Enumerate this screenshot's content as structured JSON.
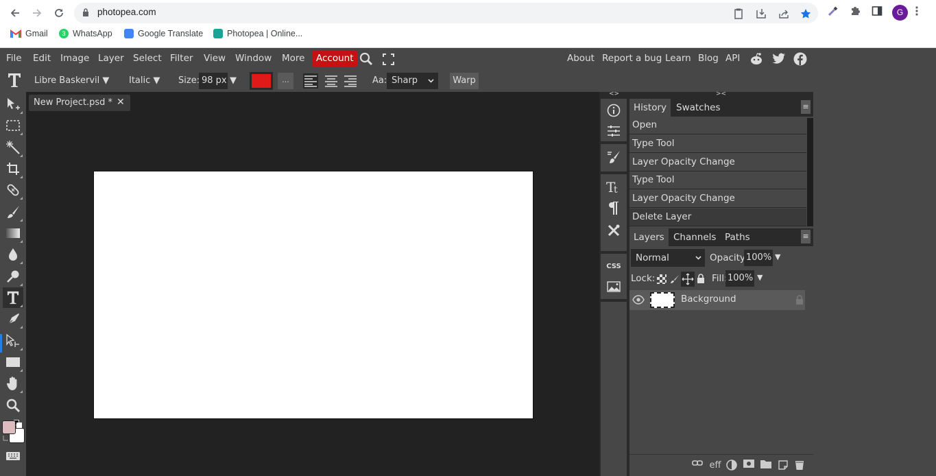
{
  "browser": {
    "url": "photopea.com",
    "bookmarks": [
      {
        "label": "Gmail",
        "icon": "gmail-icon"
      },
      {
        "label": "WhatsApp",
        "icon": "whatsapp-icon",
        "badge": "3"
      },
      {
        "label": "Google Translate",
        "icon": "google-translate-icon"
      },
      {
        "label": "Photopea | Online...",
        "icon": "photopea-icon"
      }
    ],
    "profile_initial": "G",
    "colors": {
      "avatar": "#6a1b9a",
      "star": "#1a73e8"
    }
  },
  "menubar": {
    "items": [
      "File",
      "Edit",
      "Image",
      "Layer",
      "Select",
      "Filter",
      "View",
      "Window",
      "More"
    ],
    "account_label": "Account",
    "right_links": [
      "About",
      "Report a bug",
      "Learn",
      "Blog",
      "API"
    ],
    "social": [
      "reddit-icon",
      "twitter-icon",
      "facebook-icon"
    ],
    "colors": {
      "account": "#c51111"
    }
  },
  "options": {
    "font_family": "Libre Baskervil ▼",
    "font_style": "Italic ▼",
    "size_label": "Size:",
    "size_value": "98 px",
    "size_arrow": "▼",
    "text_color": "#e01919",
    "more_label": "...",
    "aa_label": "Aa:",
    "aa_value": "Sharp",
    "warp_label": "Warp"
  },
  "document": {
    "tab_name": "New Project.psd *",
    "close": "✕"
  },
  "toolbox": {
    "tools": [
      "move-tool",
      "marquee-tool",
      "magic-wand-tool",
      "crop-tool",
      "healing-tool",
      "brush-tool",
      "gradient-tool",
      "blur-tool",
      "dodge-tool",
      "type-tool",
      "pen-tool",
      "path-select-tool",
      "rectangle-tool",
      "hand-tool",
      "zoom-tool"
    ],
    "active": "type-tool",
    "foreground": "#dcbcbf",
    "background": "#ffffff"
  },
  "side_strip": {
    "expand_left": "<>",
    "expand_right": "><",
    "css_label": "CSS"
  },
  "history_panel": {
    "tabs": [
      "History",
      "Swatches"
    ],
    "active_tab": "History",
    "items": [
      "Open",
      "Type Tool",
      "Layer Opacity Change",
      "Type Tool",
      "Layer Opacity Change",
      "Delete Layer"
    ]
  },
  "layers_panel": {
    "tabs": [
      "Layers",
      "Channels",
      "Paths"
    ],
    "active_tab": "Layers",
    "blend_mode": "Normal",
    "opacity_label": "Opacity:",
    "opacity_value": "100%",
    "lock_label": "Lock:",
    "fill_label": "Fill:",
    "fill_value": "100%",
    "layers": [
      {
        "name": "Background",
        "visible": true,
        "locked": true
      }
    ],
    "footer": [
      "link-icon",
      "effects-icon",
      "adjustment-icon",
      "mask-icon",
      "folder-icon",
      "new-layer-icon",
      "trash-icon"
    ],
    "effects_label": "eff"
  }
}
